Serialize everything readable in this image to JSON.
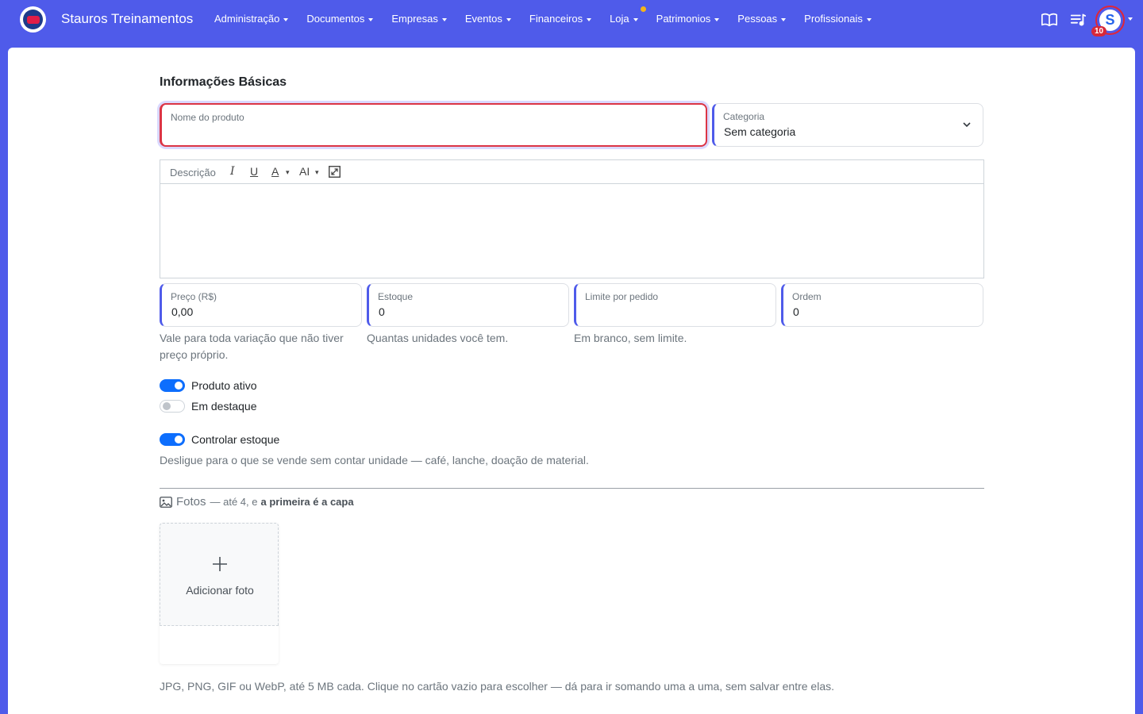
{
  "navbar": {
    "brand": "Stauros Treinamentos",
    "menu": [
      {
        "label": "Administração"
      },
      {
        "label": "Documentos"
      },
      {
        "label": "Empresas"
      },
      {
        "label": "Eventos"
      },
      {
        "label": "Financeiros"
      },
      {
        "label": "Loja"
      },
      {
        "label": "Patrimonios"
      },
      {
        "label": "Pessoas"
      },
      {
        "label": "Profissionais"
      }
    ],
    "notification_count": "10",
    "colors": {
      "bar": "#4f5bea",
      "badge": "#d6283a",
      "loja_dot": "#f5b41a"
    }
  },
  "form": {
    "section_title": "Informações Básicas",
    "product_name": {
      "label": "Nome do produto",
      "value": ""
    },
    "category": {
      "label": "Categoria",
      "value": "Sem categoria"
    },
    "editor": {
      "placeholder": "Descrição"
    },
    "price": {
      "label": "Preço (R$)",
      "value": "0,00",
      "help": "Vale para toda variação que não tiver preço próprio."
    },
    "stock": {
      "label": "Estoque",
      "value": "0",
      "help": "Quantas unidades você tem."
    },
    "order_limit": {
      "label": "Limite por pedido",
      "value": "",
      "help": "Em branco, sem limite."
    },
    "order": {
      "label": "Ordem",
      "value": "0"
    },
    "switches": {
      "active": {
        "label": "Produto ativo",
        "on": true
      },
      "featured": {
        "label": "Em destaque",
        "on": false
      },
      "stock_control": {
        "label": "Controlar estoque",
        "on": true
      }
    },
    "stock_control_help": "Desligue para o que se vende sem contar unidade — café, lanche, doação de material."
  },
  "photos": {
    "title": "Fotos",
    "subtitle_prefix": "— até 4, e",
    "subtitle_bold": "a primeira é a capa",
    "add_label": "Adicionar foto",
    "help": "JPG, PNG, GIF ou WebP, até 5 MB cada. Clique no cartão vazio para escolher — dá para ir somando uma a uma, sem salvar entre elas."
  }
}
